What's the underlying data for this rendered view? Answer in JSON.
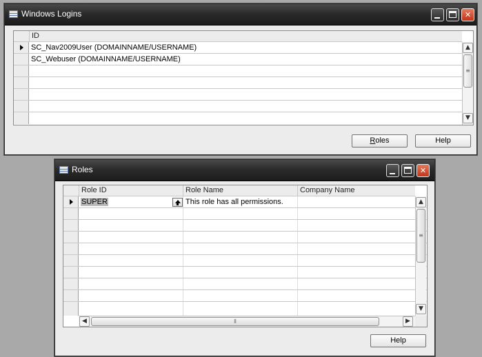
{
  "windows_logins": {
    "title": "Windows Logins",
    "column_header": "ID",
    "rows": [
      {
        "id": "SC_Nav2009User (DOMAINNAME/USERNAME)"
      },
      {
        "id": "SC_Webuser (DOMAINNAME/USERNAME)"
      },
      {
        "id": ""
      },
      {
        "id": ""
      },
      {
        "id": ""
      },
      {
        "id": ""
      },
      {
        "id": ""
      }
    ],
    "buttons": {
      "roles_prefix": "",
      "roles_accel": "R",
      "roles_suffix": "oles",
      "help": "Help"
    }
  },
  "roles": {
    "title": "Roles",
    "columns": [
      "Role ID",
      "Role Name",
      "Company Name"
    ],
    "rows": [
      {
        "role_id": "SUPER",
        "role_name": "This role has all permissions.",
        "company": ""
      }
    ],
    "buttons": {
      "help": "Help"
    }
  },
  "colors": {
    "background": "#a9a9a9",
    "titlebar": "#2b2b2b",
    "close": "#c0341a"
  },
  "icons": [
    "table-icon",
    "minimize-icon",
    "maximize-icon",
    "close-icon",
    "lookup-icon",
    "scroll-up-icon",
    "scroll-down-icon",
    "scroll-left-icon",
    "scroll-right-icon"
  ]
}
